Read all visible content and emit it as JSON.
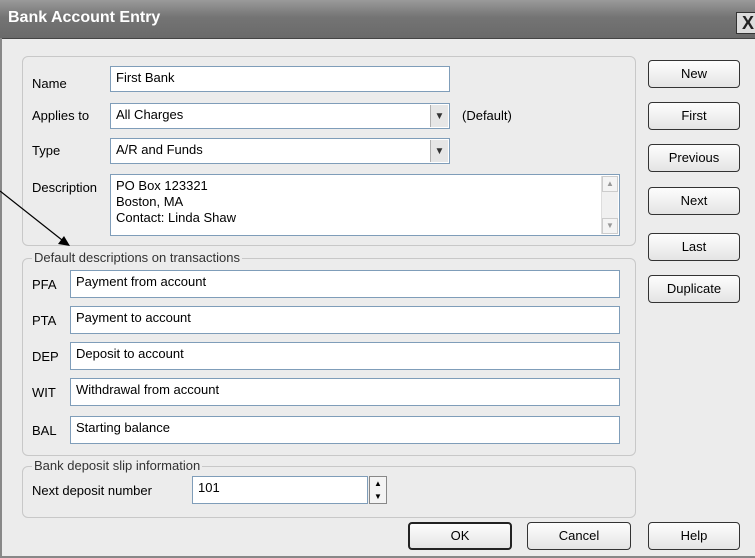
{
  "window": {
    "title": "Bank Account Entry",
    "close_glyph": "X"
  },
  "form": {
    "name": {
      "label": "Name",
      "value": "First Bank"
    },
    "applies_to": {
      "label": "Applies to",
      "value": "All Charges",
      "default_note": "(Default)"
    },
    "type": {
      "label": "Type",
      "value": "A/R and Funds"
    },
    "description": {
      "label": "Description",
      "lines": [
        "PO Box 123321",
        "Boston, MA",
        "Contact: Linda Shaw"
      ]
    }
  },
  "default_descriptions": {
    "title": "Default descriptions on transactions",
    "rows": [
      {
        "code": "PFA",
        "value": "Payment from account"
      },
      {
        "code": "PTA",
        "value": "Payment to account"
      },
      {
        "code": "DEP",
        "value": "Deposit to account"
      },
      {
        "code": "WIT",
        "value": "Withdrawal from account"
      },
      {
        "code": "BAL",
        "value": "Starting balance"
      }
    ]
  },
  "deposit_slip": {
    "title": "Bank deposit slip information",
    "next_number_label": "Next deposit number",
    "next_number_value": "101"
  },
  "side_buttons": [
    "New",
    "First",
    "Previous",
    "Next",
    "Last",
    "Duplicate"
  ],
  "bottom_buttons": {
    "ok": "OK",
    "cancel": "Cancel",
    "help": "Help"
  }
}
